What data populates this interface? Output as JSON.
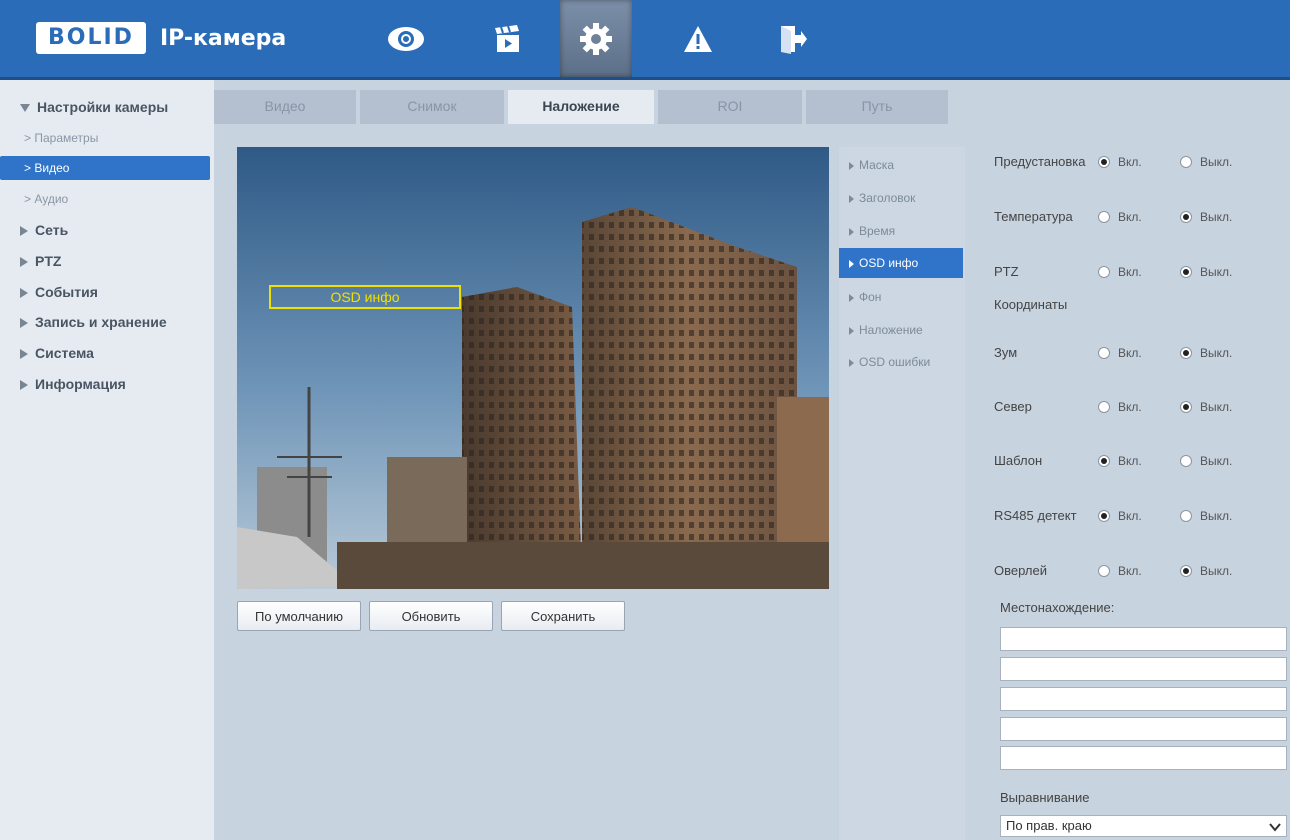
{
  "header": {
    "logo_text": "BOLID",
    "app_title": "IP-камера",
    "icons": [
      "eye-icon",
      "clapperboard-icon",
      "gear-icon",
      "warning-icon",
      "logout-icon"
    ],
    "active_icon": "gear-icon",
    "color": "#2b6cb8"
  },
  "sidebar": {
    "camera_settings": "Настройки камеры",
    "items": [
      {
        "label": "Параметры"
      },
      {
        "label": "Видео"
      },
      {
        "label": "Аудио"
      }
    ],
    "groups": [
      "Сеть",
      "PTZ",
      "События",
      "Запись и хранение",
      "Система",
      "Информация"
    ]
  },
  "tabs": [
    "Видео",
    "Снимок",
    "Наложение",
    "ROI",
    "Путь"
  ],
  "active_tab": "Наложение",
  "preview": {
    "osd_box_label": "OSD инфо"
  },
  "buttons": {
    "default": "По умолчанию",
    "refresh": "Обновить",
    "save": "Сохранить"
  },
  "submenu": [
    "Маска",
    "Заголовок",
    "Время",
    "OSD инфо",
    "Фон",
    "Наложение",
    "OSD ошибки"
  ],
  "active_submenu": "OSD инфо",
  "settings": {
    "on_label": "Вкл.",
    "off_label": "Выкл.",
    "rows": [
      {
        "label": "Предустановка",
        "value": "on"
      },
      {
        "label": "Температура",
        "value": "off"
      },
      {
        "label": "PTZ",
        "label2": "Координаты",
        "value": "off"
      },
      {
        "label": "Зум",
        "value": "off"
      },
      {
        "label": "Север",
        "value": "off"
      },
      {
        "label": "Шаблон",
        "value": "on"
      },
      {
        "label": "RS485 детект",
        "value": "on"
      },
      {
        "label": "Оверлей",
        "value": "off"
      }
    ],
    "location_label": "Местонахождение:",
    "location_lines": [
      "",
      "",
      "",
      "",
      ""
    ],
    "alignment_label": "Выравнивание",
    "alignment_value": "По прав. краю"
  },
  "colors": {
    "accent": "#2f74c9",
    "osd_box": "#f0e000"
  }
}
